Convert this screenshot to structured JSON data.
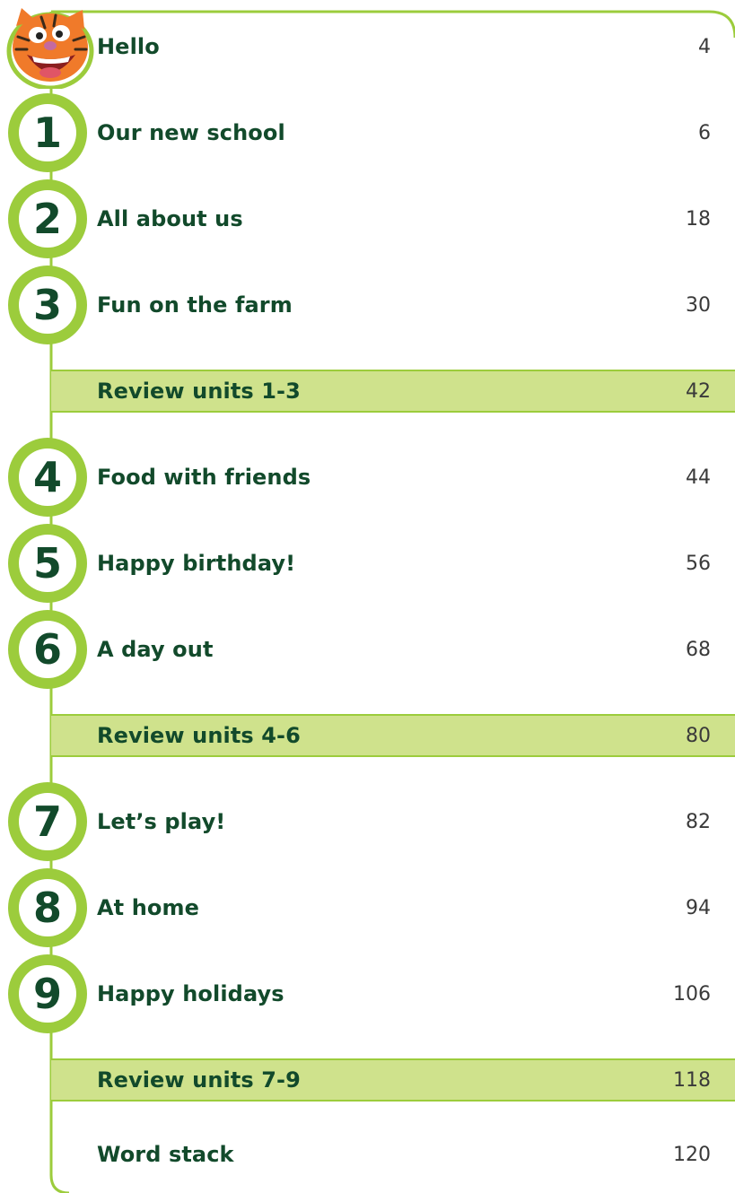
{
  "toc": {
    "hello": {
      "title": "Hello",
      "page": "4"
    },
    "units": [
      {
        "number": "1",
        "title": "Our new school",
        "page": "6"
      },
      {
        "number": "2",
        "title": "All about us",
        "page": "18"
      },
      {
        "number": "3",
        "title": "Fun on the farm",
        "page": "30"
      },
      {
        "number": "4",
        "title": "Food with friends",
        "page": "44"
      },
      {
        "number": "5",
        "title": "Happy birthday!",
        "page": "56"
      },
      {
        "number": "6",
        "title": "A day out",
        "page": "68"
      },
      {
        "number": "7",
        "title": "Let’s play!",
        "page": "82"
      },
      {
        "number": "8",
        "title": "At home",
        "page": "94"
      },
      {
        "number": "9",
        "title": "Happy holidays",
        "page": "106"
      }
    ],
    "reviews": [
      {
        "title": "Review units 1-3",
        "page": "42"
      },
      {
        "title": "Review units 4-6",
        "page": "80"
      },
      {
        "title": "Review units 7-9",
        "page": "118"
      }
    ],
    "word_stack": {
      "title": "Word stack",
      "page": "120"
    }
  },
  "colors": {
    "accent_green": "#9ccc3c",
    "review_fill": "#cfe28c",
    "title_text": "#124a2b",
    "page_text": "#3a3a3a"
  },
  "icons": {
    "mascot": "tiger-mascot-icon"
  }
}
